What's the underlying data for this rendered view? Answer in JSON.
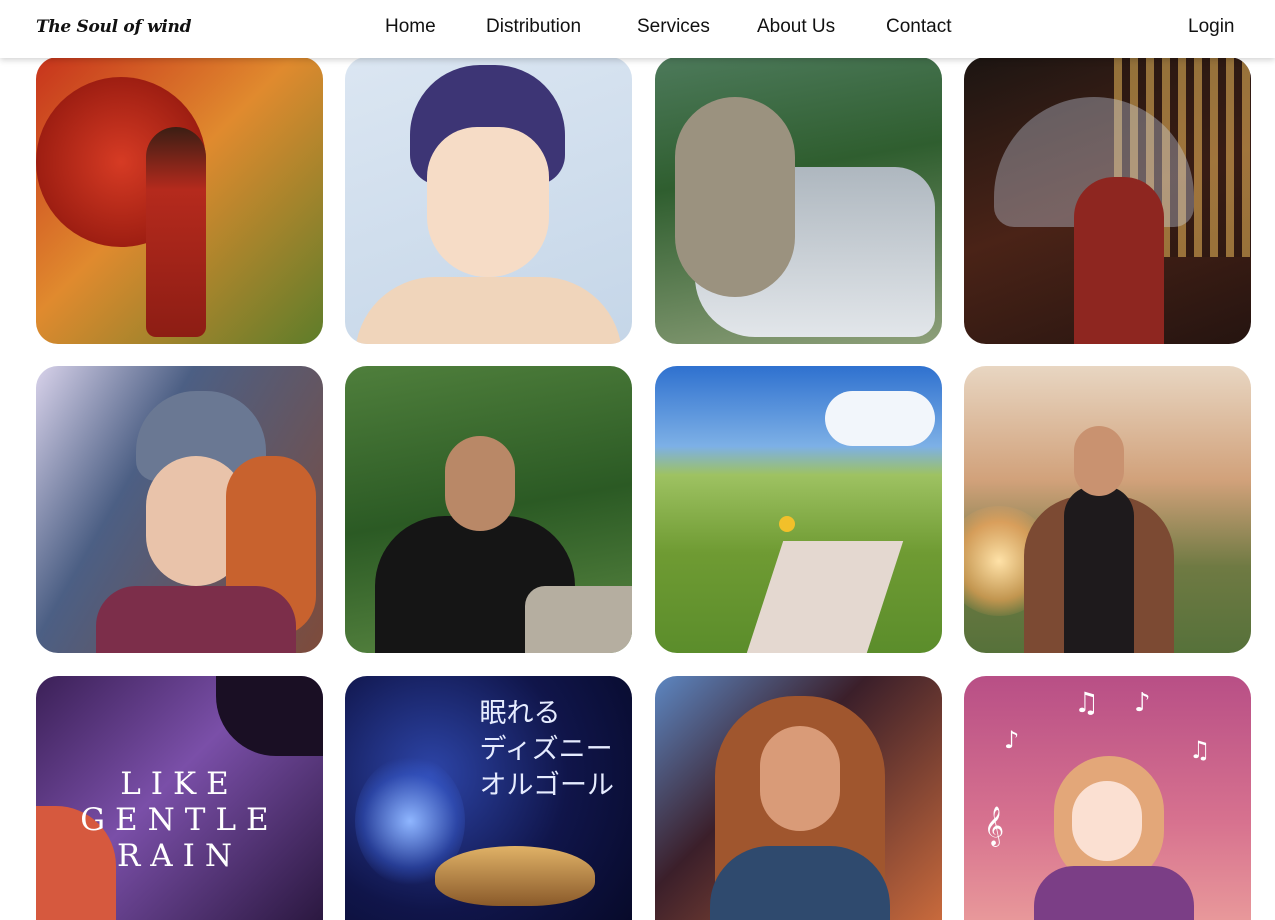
{
  "header": {
    "logo": "The Soul of wind",
    "nav": [
      "Home",
      "Distribution",
      "Services",
      "About Us",
      "Contact"
    ],
    "login": "Login"
  },
  "tiles": [
    {
      "name": "red-umbrella-lady-art",
      "palette": [
        "#b2301c",
        "#e2a33a",
        "#6e8a2a"
      ]
    },
    {
      "name": "smiling-glasses-boy-art",
      "palette": [
        "#cfdcea",
        "#3f3a6b",
        "#f4d9c3"
      ]
    },
    {
      "name": "sleeping-girl-forest-art",
      "palette": [
        "#3e6a3b",
        "#c7cfd6",
        "#8d9b6a"
      ]
    },
    {
      "name": "city-umbrella-night-art",
      "palette": [
        "#2b1a16",
        "#c1482c",
        "#e9c16b"
      ]
    },
    {
      "name": "headphone-girl-art",
      "palette": [
        "#5d6f8c",
        "#c55a2d",
        "#d9d0e6"
      ]
    },
    {
      "name": "flute-player-photo",
      "palette": [
        "#2e5a2a",
        "#1b1b1b",
        "#7aa05a"
      ]
    },
    {
      "name": "green-fields-landscape-art",
      "palette": [
        "#3e7fd3",
        "#7dae3f",
        "#e7e0cf"
      ]
    },
    {
      "name": "man-sunset-field-photo",
      "palette": [
        "#f2b36a",
        "#4a3a2e",
        "#7c8a4a"
      ]
    },
    {
      "name": "like-gentle-rain-cover",
      "palette": [
        "#3a2156",
        "#8a62b7",
        "#e0604a"
      ],
      "title_lines": [
        "LIKE",
        "GENTLE",
        "RAIN"
      ]
    },
    {
      "name": "disney-music-box-cover",
      "palette": [
        "#0b0f3a",
        "#2b3c8c",
        "#c59b4a"
      ],
      "title_lines": [
        "眠れる",
        "ディズニー",
        "オルゴール"
      ]
    },
    {
      "name": "woman-lights-photo",
      "palette": [
        "#3a1f2a",
        "#d77a45",
        "#6fa1d6"
      ]
    },
    {
      "name": "music-notes-girl-art",
      "palette": [
        "#c4588c",
        "#e98c93",
        "#ffffff"
      ]
    }
  ]
}
